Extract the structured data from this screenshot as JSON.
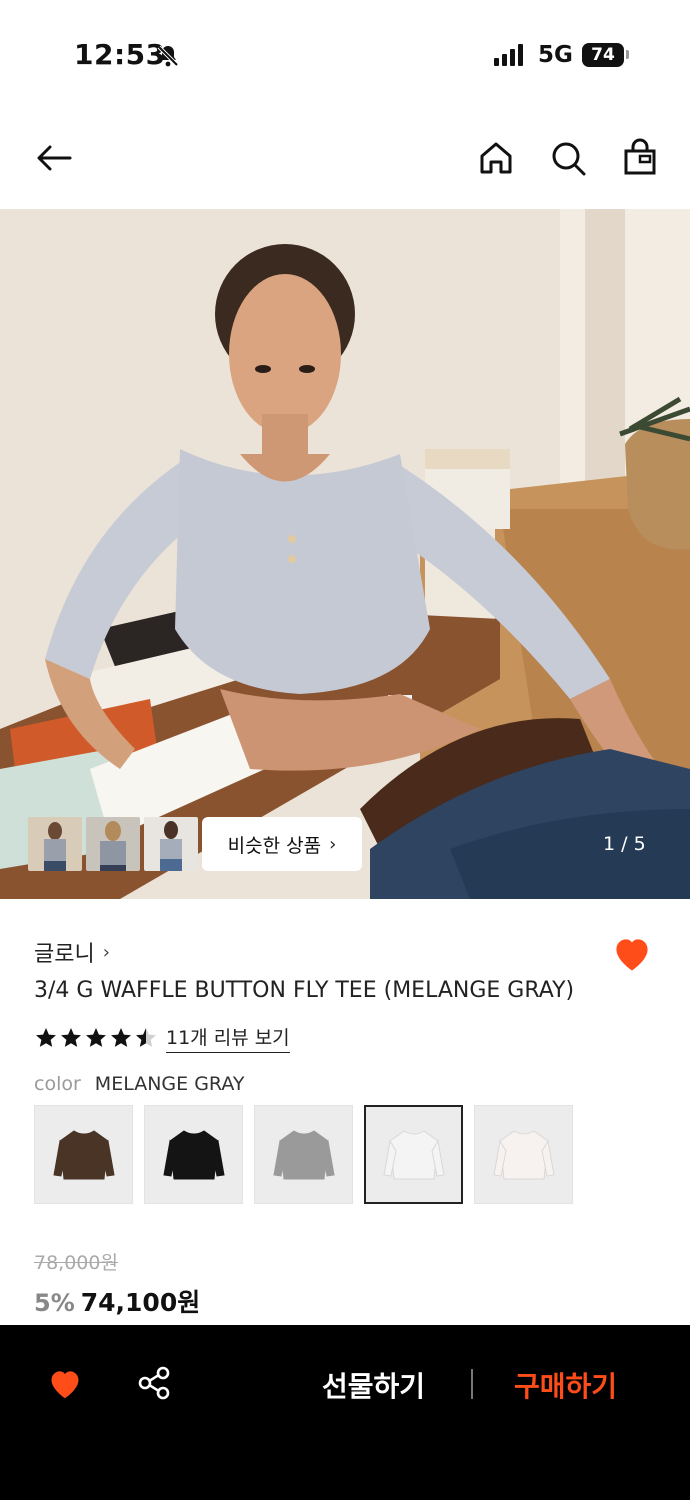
{
  "status_bar": {
    "time": "12:53",
    "network": "5G",
    "battery": "74",
    "icons": [
      "bell-slash-icon",
      "signal-icon"
    ]
  },
  "nav": {
    "icons": [
      "back-arrow-icon",
      "home-icon",
      "search-icon",
      "shopping-bag-icon"
    ]
  },
  "gallery": {
    "similar_label": "비슷한 상품",
    "page_indicator": "1 / 5"
  },
  "product": {
    "brand": "글로니",
    "title": "3/4 G WAFFLE BUTTON FLY TEE (MELANGE GRAY)",
    "rating": 4.5,
    "review_label": "11개 리뷰 보기",
    "color_label": "color",
    "color_value": "MELANGE GRAY",
    "swatches": [
      {
        "color": "#4a3426"
      },
      {
        "color": "#141414"
      },
      {
        "color": "#9a9a9a"
      },
      {
        "color": "#f4f4f4"
      },
      {
        "color": "#f7f2ef"
      }
    ],
    "selected_swatch": 3,
    "original_price": "78,000원",
    "discount": "5%",
    "sale_price": "74,100원"
  },
  "bottom_bar": {
    "gift_label": "선물하기",
    "buy_label": "구매하기"
  },
  "colors": {
    "accent": "#ff4d1a",
    "bottom_bar_bg": "#000000"
  }
}
